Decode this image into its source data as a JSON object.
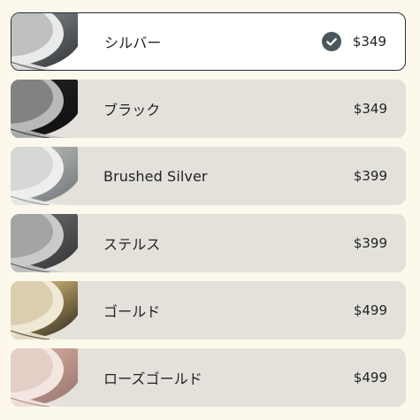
{
  "options": [
    {
      "name": "シルバー",
      "price": "$349",
      "selected": true,
      "icon": "ring-silver-icon",
      "colors": {
        "band": "#6f7376",
        "bandLight": "#c8cbcd",
        "edge": "#2c2f31",
        "inner": "#e9eaea"
      }
    },
    {
      "name": "ブラック",
      "price": "$349",
      "selected": false,
      "icon": "ring-black-icon",
      "colors": {
        "band": "#1d1e1f",
        "bandLight": "#4a4c4e",
        "edge": "#0c0c0c",
        "inner": "#b7b9ba"
      }
    },
    {
      "name": "Brushed Silver",
      "price": "$399",
      "selected": false,
      "icon": "ring-brushed-silver-icon",
      "colors": {
        "band": "#a9acad",
        "bandLight": "#d4d6d7",
        "edge": "#6d7072",
        "inner": "#eeeeee"
      }
    },
    {
      "name": "ステルス",
      "price": "$399",
      "selected": false,
      "icon": "ring-stealth-icon",
      "colors": {
        "band": "#5c5e60",
        "bandLight": "#8a8c8e",
        "edge": "#2e2f30",
        "inner": "#c9cacb"
      }
    },
    {
      "name": "ゴールド",
      "price": "$499",
      "selected": false,
      "icon": "ring-gold-icon",
      "colors": {
        "band": "#b79f66",
        "bandLight": "#e2cf9a",
        "edge": "#1f1c16",
        "inner": "#efe8d4"
      }
    },
    {
      "name": "ローズゴールド",
      "price": "$499",
      "selected": false,
      "icon": "ring-rose-gold-icon",
      "colors": {
        "band": "#c9a096",
        "bandLight": "#ecd2c9",
        "edge": "#8f6f68",
        "inner": "#f3e6e1"
      }
    }
  ]
}
